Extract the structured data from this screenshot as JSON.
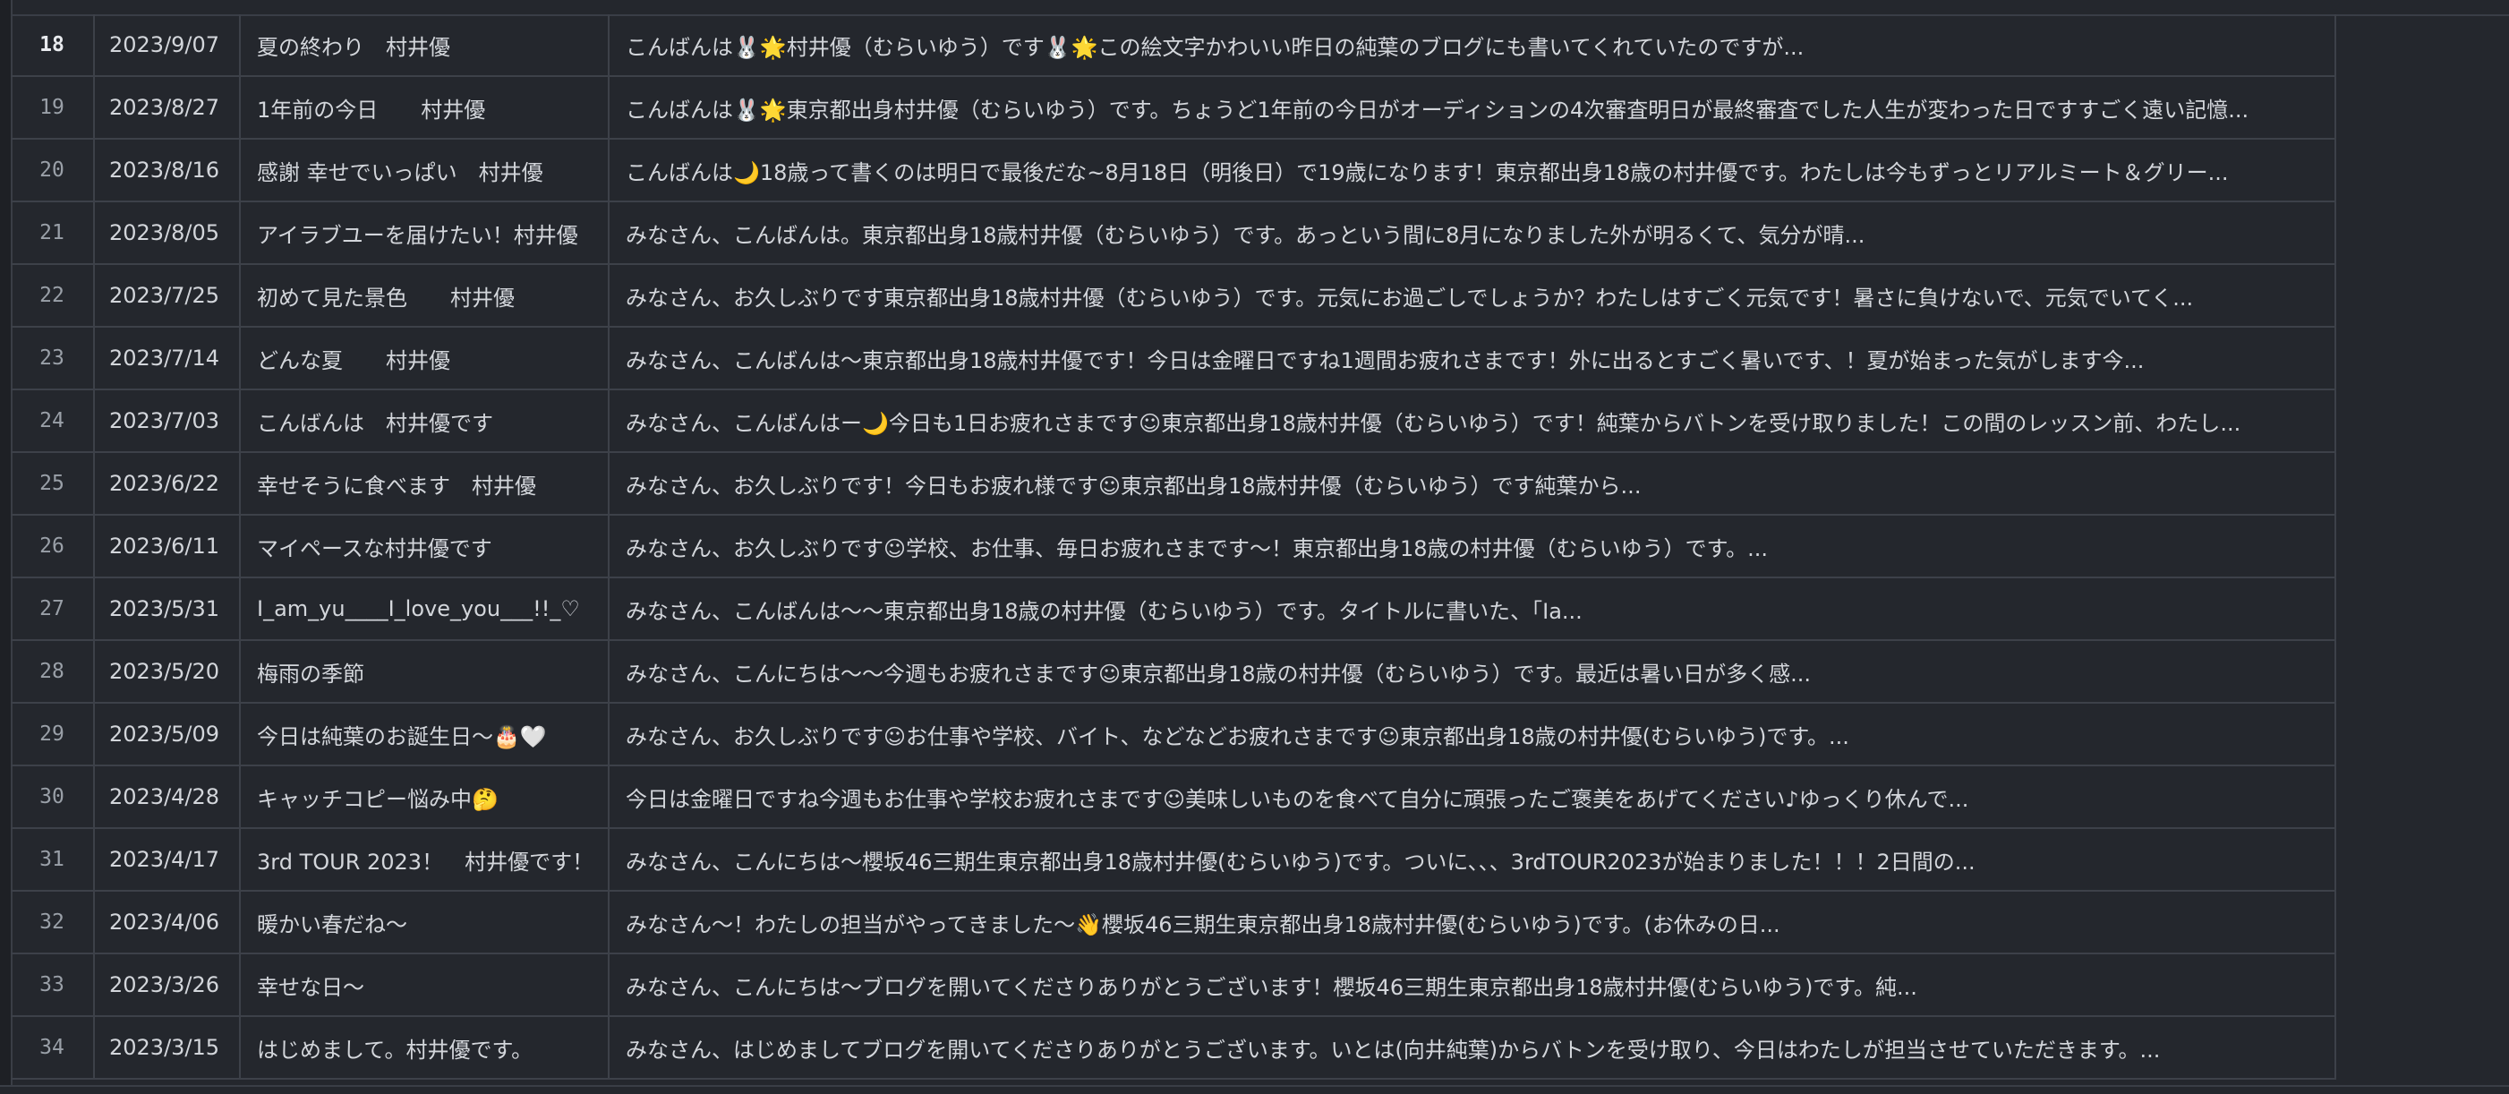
{
  "colors": {
    "background": "#24272d",
    "grid_line": "#3d4149",
    "text": "#d3d6db",
    "row_number": "#9aa0a8"
  },
  "table": {
    "active_row": "18",
    "rows": [
      {
        "num": "18",
        "date": "2023/9/07",
        "title": "夏の終わり　村井優",
        "body": "こんばんは🐰🌟村井優（むらいゆう）です🐰🌟この絵文字かわいい昨日の純葉のブログにも書いてくれていたのですが..."
      },
      {
        "num": "19",
        "date": "2023/8/27",
        "title": "1年前の今日　　村井優",
        "body": "こんばんは🐰🌟東京都出身村井優（むらいゆう）です。ちょうど1年前の今日がオーディションの4次審査明日が最終審査でした人生が変わった日ですすごく遠い記憶..."
      },
      {
        "num": "20",
        "date": "2023/8/16",
        "title": "感謝 幸せでいっぱい　村井優",
        "body": "こんばんは🌙18歳って書くのは明日で最後だな~8月18日（明後日）で19歳になります！東京都出身18歳の村井優です。わたしは今もずっとリアルミート＆グリー..."
      },
      {
        "num": "21",
        "date": "2023/8/05",
        "title": "アイラブユーを届けたい！村井優",
        "body": "みなさん、こんばんは。東京都出身18歳村井優（むらいゆう）です。あっという間に8月になりました外が明るくて、気分が晴..."
      },
      {
        "num": "22",
        "date": "2023/7/25",
        "title": "初めて見た景色　　村井優",
        "body": "みなさん、お久しぶりです東京都出身18歳村井優（むらいゆう）です。元気にお過ごしでしょうか？わたしはすごく元気です！暑さに負けないで、元気でいてく..."
      },
      {
        "num": "23",
        "date": "2023/7/14",
        "title": "どんな夏　　村井優",
        "body": "みなさん、こんばんは〜東京都出身18歳村井優です！今日は金曜日ですね1週間お疲れさまです！外に出るとすごく暑いです、！夏が始まった気がします今..."
      },
      {
        "num": "24",
        "date": "2023/7/03",
        "title": "こんばんは　村井優です",
        "body": "みなさん、こんばんはー🌙今日も1日お疲れさまです☺東京都出身18歳村井優（むらいゆう）です！純葉からバトンを受け取りました！この間のレッスン前、わたし..."
      },
      {
        "num": "25",
        "date": "2023/6/22",
        "title": "幸せそうに食べます　村井優",
        "body": "みなさん、お久しぶりです！今日もお疲れ様です☺東京都出身18歳村井優（むらいゆう）です純葉から..."
      },
      {
        "num": "26",
        "date": "2023/6/11",
        "title": "マイペースな村井優です",
        "body": "みなさん、お久しぶりです☺学校、お仕事、毎日お疲れさまです〜！東京都出身18歳の村井優（むらいゆう）です。..."
      },
      {
        "num": "27",
        "date": "2023/5/31",
        "title": "I_am_yu____I_love_you___!!_♡",
        "body": "みなさん、こんばんは〜〜東京都出身18歳の村井優（むらいゆう）です。タイトルに書いた、「Ia..."
      },
      {
        "num": "28",
        "date": "2023/5/20",
        "title": "梅雨の季節",
        "body": "みなさん、こんにちは〜〜今週もお疲れさまです☺東京都出身18歳の村井優（むらいゆう）です。最近は暑い日が多く感..."
      },
      {
        "num": "29",
        "date": "2023/5/09",
        "title": "今日は純葉のお誕生日〜🎂🤍",
        "body": "みなさん、お久しぶりです☺お仕事や学校、バイト、などなどお疲れさまです☺東京都出身18歳の村井優(むらいゆう)です。..."
      },
      {
        "num": "30",
        "date": "2023/4/28",
        "title": "キャッチコピー悩み中🤔",
        "body": "今日は金曜日ですね今週もお仕事や学校お疲れさまです☺美味しいものを食べて自分に頑張ったご褒美をあげてください♪ゆっくり休んで..."
      },
      {
        "num": "31",
        "date": "2023/4/17",
        "title": "3rd TOUR 2023！　村井優です！",
        "body": "みなさん、こんにちは〜櫻坂46三期生東京都出身18歳村井優(むらいゆう)です。ついに、、、3rdTOUR2023が始まりました！！！2日間の..."
      },
      {
        "num": "32",
        "date": "2023/4/06",
        "title": "暖かい春だね〜",
        "body": "みなさん〜！わたしの担当がやってきました〜👋櫻坂46三期生東京都出身18歳村井優(むらいゆう)です。(お休みの日..."
      },
      {
        "num": "33",
        "date": "2023/3/26",
        "title": "幸せな日〜",
        "body": "みなさん、こんにちは〜ブログを開いてくださりありがとうございます！櫻坂46三期生東京都出身18歳村井優(むらいゆう)です。純..."
      },
      {
        "num": "34",
        "date": "2023/3/15",
        "title": "はじめまして。村井優です。",
        "body": "みなさん、はじめましてブログを開いてくださりありがとうございます。いとは(向井純葉)からバトンを受け取り、今日はわたしが担当させていただきます。..."
      }
    ]
  }
}
